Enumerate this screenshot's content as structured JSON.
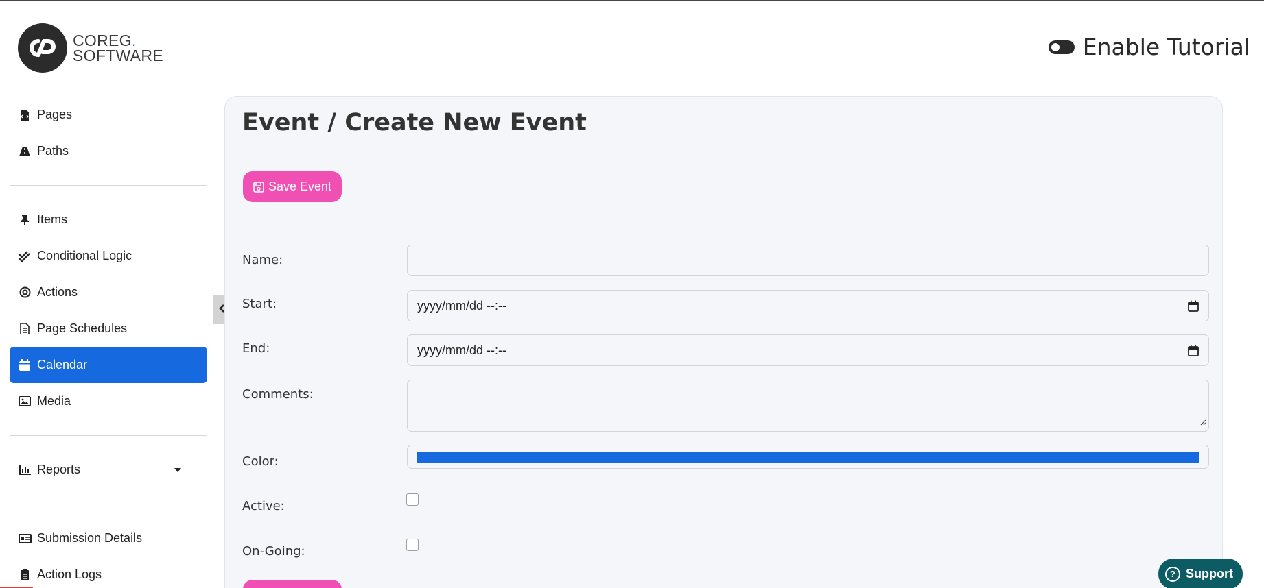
{
  "brand": {
    "line1": "COREG",
    "dot": ".",
    "line2": "SOFTWARE"
  },
  "tutorial": {
    "label": "Enable Tutorial",
    "enabled": false
  },
  "sidebar": {
    "groups": [
      [
        {
          "label": "Pages",
          "icon": "file-code-icon"
        },
        {
          "label": "Paths",
          "icon": "road-icon"
        }
      ],
      [
        {
          "label": "Items",
          "icon": "pin-icon"
        },
        {
          "label": "Conditional Logic",
          "icon": "double-check-icon"
        },
        {
          "label": "Actions",
          "icon": "target-icon"
        },
        {
          "label": "Page Schedules",
          "icon": "file-lines-icon"
        },
        {
          "label": "Calendar",
          "icon": "calendar-icon",
          "active": true
        },
        {
          "label": "Media",
          "icon": "image-icon"
        }
      ],
      [
        {
          "label": "Reports",
          "icon": "bar-chart-icon",
          "dropdown": true
        }
      ],
      [
        {
          "label": "Submission Details",
          "icon": "id-card-icon"
        },
        {
          "label": "Action Logs",
          "icon": "clipboard-list-icon"
        }
      ]
    ]
  },
  "main": {
    "title": "Event / Create New Event",
    "save_label": "Save Event",
    "form": {
      "name_label": "Name:",
      "name_value": "",
      "start_label": "Start:",
      "start_value": "yyyy/mm/dd --:--",
      "end_label": "End:",
      "end_value": "yyyy/mm/dd --:--",
      "comments_label": "Comments:",
      "comments_value": "",
      "color_label": "Color:",
      "color_value": "#1769e0",
      "active_label": "Active:",
      "active_checked": false,
      "ongoing_label": "On-Going:",
      "ongoing_checked": false
    }
  },
  "support": {
    "label": "Support"
  },
  "colors": {
    "accent_pink": "#f04fb4",
    "active_blue": "#1769e0",
    "support_teal": "#0d5b63"
  }
}
